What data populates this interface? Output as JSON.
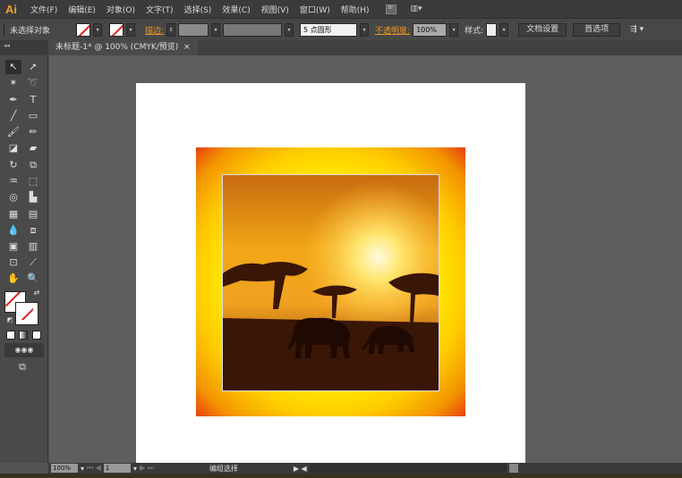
{
  "app": {
    "logo": "Ai"
  },
  "menu": [
    "文件(F)",
    "编辑(E)",
    "对象(O)",
    "文字(T)",
    "选择(S)",
    "效果(C)",
    "视图(V)",
    "窗口(W)",
    "帮助(H)"
  ],
  "bridge_label": "Br",
  "control": {
    "selection": "未选择对象",
    "stroke_label": "描边:",
    "brush": "5 点圆形",
    "opacity_label": "不透明度:",
    "opacity": "100%",
    "style_label": "样式:",
    "doc_setup": "文档设置",
    "preferences": "首选项"
  },
  "tab": {
    "title": "未标题-1* @ 100% (CMYK/预览)",
    "close": "×"
  },
  "status": {
    "zoom": "100%",
    "page": "1",
    "tool": "编组选择"
  },
  "colors": {
    "accent": "#e8962a",
    "frame_outer": "#e64010",
    "frame_inner": "#ffe800"
  }
}
